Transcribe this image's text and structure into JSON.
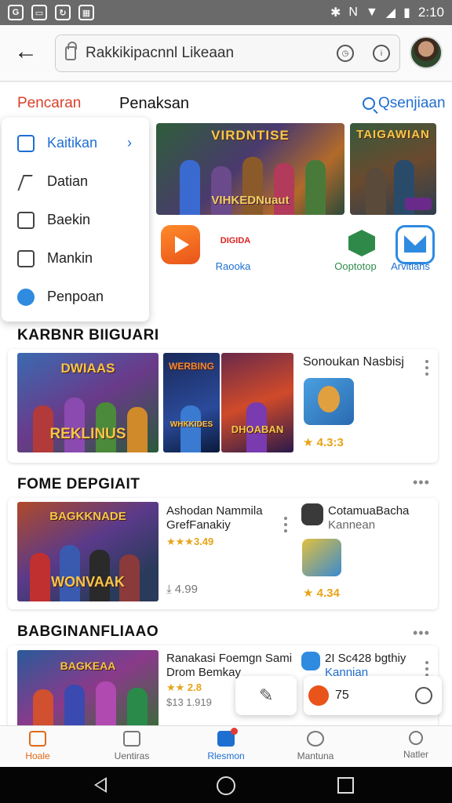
{
  "status_bar": {
    "time": "2:10"
  },
  "app_bar": {
    "url_text": "Rakkikipacnnl Likeaan"
  },
  "tabs": {
    "first": "Pencaran",
    "second": "Penaksan",
    "search": "Qsenjiaan"
  },
  "dropdown": {
    "items": [
      {
        "label": "Kaitikan",
        "active": true
      },
      {
        "label": "Datian",
        "active": false
      },
      {
        "label": "Baekin",
        "active": false
      },
      {
        "label": "Mankin",
        "active": false
      },
      {
        "label": "Penpoan",
        "active": false
      }
    ]
  },
  "banners": {
    "b1_title": "VIRDNTISE",
    "b1_sub": "VIHKEDNuaut",
    "b2_title": "TAIGAWIAN"
  },
  "app_icons": {
    "a2_badge": "DIGIDA",
    "a2_label": "Raooka",
    "a3_label": "Ooptotop",
    "a4_label": "Arvitiahs"
  },
  "section1": {
    "title": "KARBNR BIIGUARI",
    "thumb1_title": "DWIAAS",
    "thumb1_sub": "REKLINUS",
    "thumb2_title": "WERBING",
    "thumb2_sub": "WHKKIDES",
    "thumb3_sub": "DHOABAN",
    "app_title": "Sonoukan Nasbisj",
    "rating": "★ 4.3:3"
  },
  "section2": {
    "title": "FOME DEPGIAIT",
    "thumb_title": "BAGKKNADE",
    "thumb_sub": "WONVAAK",
    "item1_line1": "Ashodan Nammila",
    "item1_line2": "GrefFanakiy",
    "item1_rating": "★★★3.49",
    "item1_downloads": "⤓ 4.99",
    "item2_line1": "CotamuaBacha",
    "item2_line2": "Kannean",
    "item2_rating": "★ 4.34"
  },
  "section3": {
    "title": "BABGINANFLIAAO",
    "thumb_title": "BAGKEAA",
    "item1_line1": "Ranakasi Foemgn Sami",
    "item1_line2": "Drom Bemkay",
    "item1_rating": "★★ 2.8",
    "item1_extra": "$13 1.919",
    "item2_line1": "2I Sc428 bgthiy",
    "item2_line2": "Kannian"
  },
  "floating": {
    "count": "75"
  },
  "bottom_nav": {
    "items": [
      {
        "label": "Hoale"
      },
      {
        "label": "Uentiras"
      },
      {
        "label": "Rlesmon"
      },
      {
        "label": "Mantuna"
      },
      {
        "label": "Natler"
      }
    ]
  },
  "colors": {
    "accent_orange": "#e06a17",
    "accent_blue": "#1f6fd1",
    "tab_red": "#d8412b",
    "rating_gold": "#e8a317"
  }
}
